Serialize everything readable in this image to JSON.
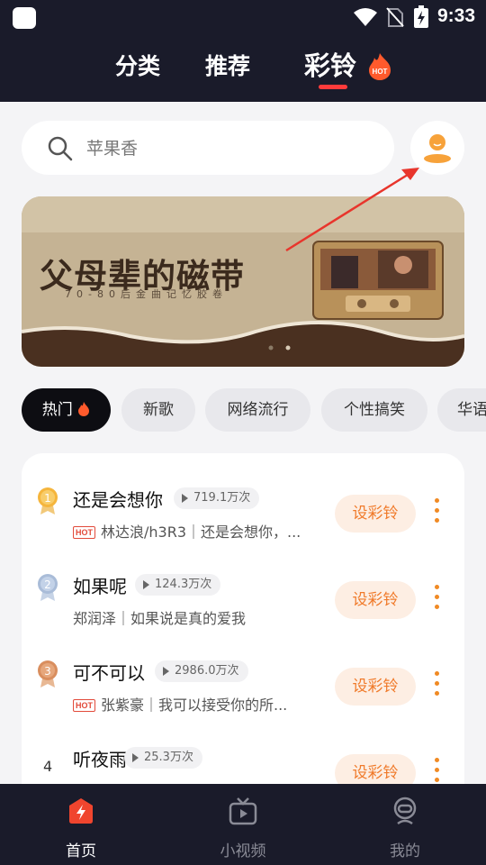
{
  "status": {
    "time": "9:33"
  },
  "tabs": [
    {
      "label": "分类"
    },
    {
      "label": "推荐"
    },
    {
      "label": "彩铃",
      "badge": "HOT",
      "active": true
    }
  ],
  "search": {
    "placeholder": "苹果香"
  },
  "banner": {
    "title": "父母辈的磁带",
    "subtitle": "70-80后金曲记忆胶卷"
  },
  "chips": [
    {
      "label": "热门",
      "active": true
    },
    {
      "label": "新歌"
    },
    {
      "label": "网络流行"
    },
    {
      "label": "个性搞笑"
    },
    {
      "label": "华语"
    }
  ],
  "songs": [
    {
      "rank": "1",
      "title": "还是会想你",
      "plays": "719.1万次",
      "hot": true,
      "hot_label": "HOT",
      "desc": "林达浪/h3R3｜还是会想你，...",
      "action": "设彩铃"
    },
    {
      "rank": "2",
      "title": "如果呢",
      "plays": "124.3万次",
      "hot": false,
      "desc": "郑润泽｜如果说是真的爱我",
      "action": "设彩铃"
    },
    {
      "rank": "3",
      "title": "可不可以",
      "plays": "2986.0万次",
      "hot": true,
      "hot_label": "HOT",
      "desc": "张紫豪｜我可以接受你的所...",
      "action": "设彩铃"
    },
    {
      "rank": "4",
      "title": "听夜雨",
      "plays": "25.3万次",
      "hot": false,
      "desc": "",
      "action": "设彩铃"
    }
  ],
  "bottom_nav": [
    {
      "label": "首页",
      "active": true,
      "icon": "home-bolt-icon"
    },
    {
      "label": "小视频",
      "icon": "tv-play-icon"
    },
    {
      "label": "我的",
      "icon": "profile-icon"
    }
  ],
  "colors": {
    "header_bg": "#1a1b2a",
    "accent_orange": "#f07a2a",
    "accent_red": "#ff3b3b",
    "hot_red": "#e24a3a"
  }
}
